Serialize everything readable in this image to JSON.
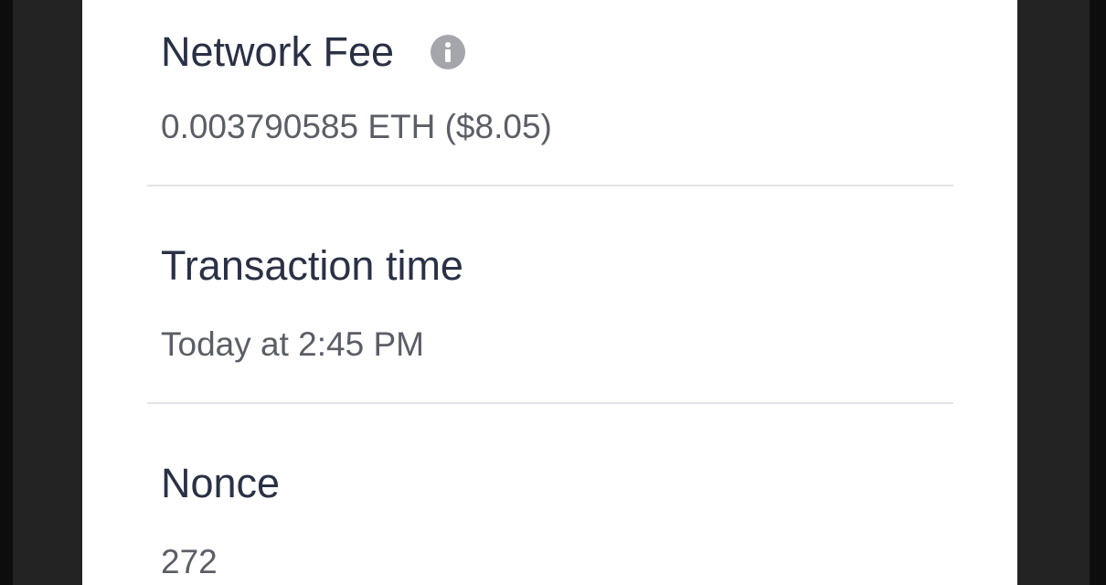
{
  "details": {
    "network_fee": {
      "label": "Network Fee",
      "value": "0.003790585 ETH ($8.05)",
      "info_icon": "info-icon"
    },
    "transaction_time": {
      "label": "Transaction time",
      "value": "Today at 2:45 PM"
    },
    "nonce": {
      "label": "Nonce",
      "value": "272"
    }
  },
  "colors": {
    "background": "#ffffff",
    "frame": "#232323",
    "label_text": "#2a3145",
    "value_text": "#5b5e66",
    "divider": "#e3e4e7",
    "info_icon": "#a4a6ab"
  }
}
